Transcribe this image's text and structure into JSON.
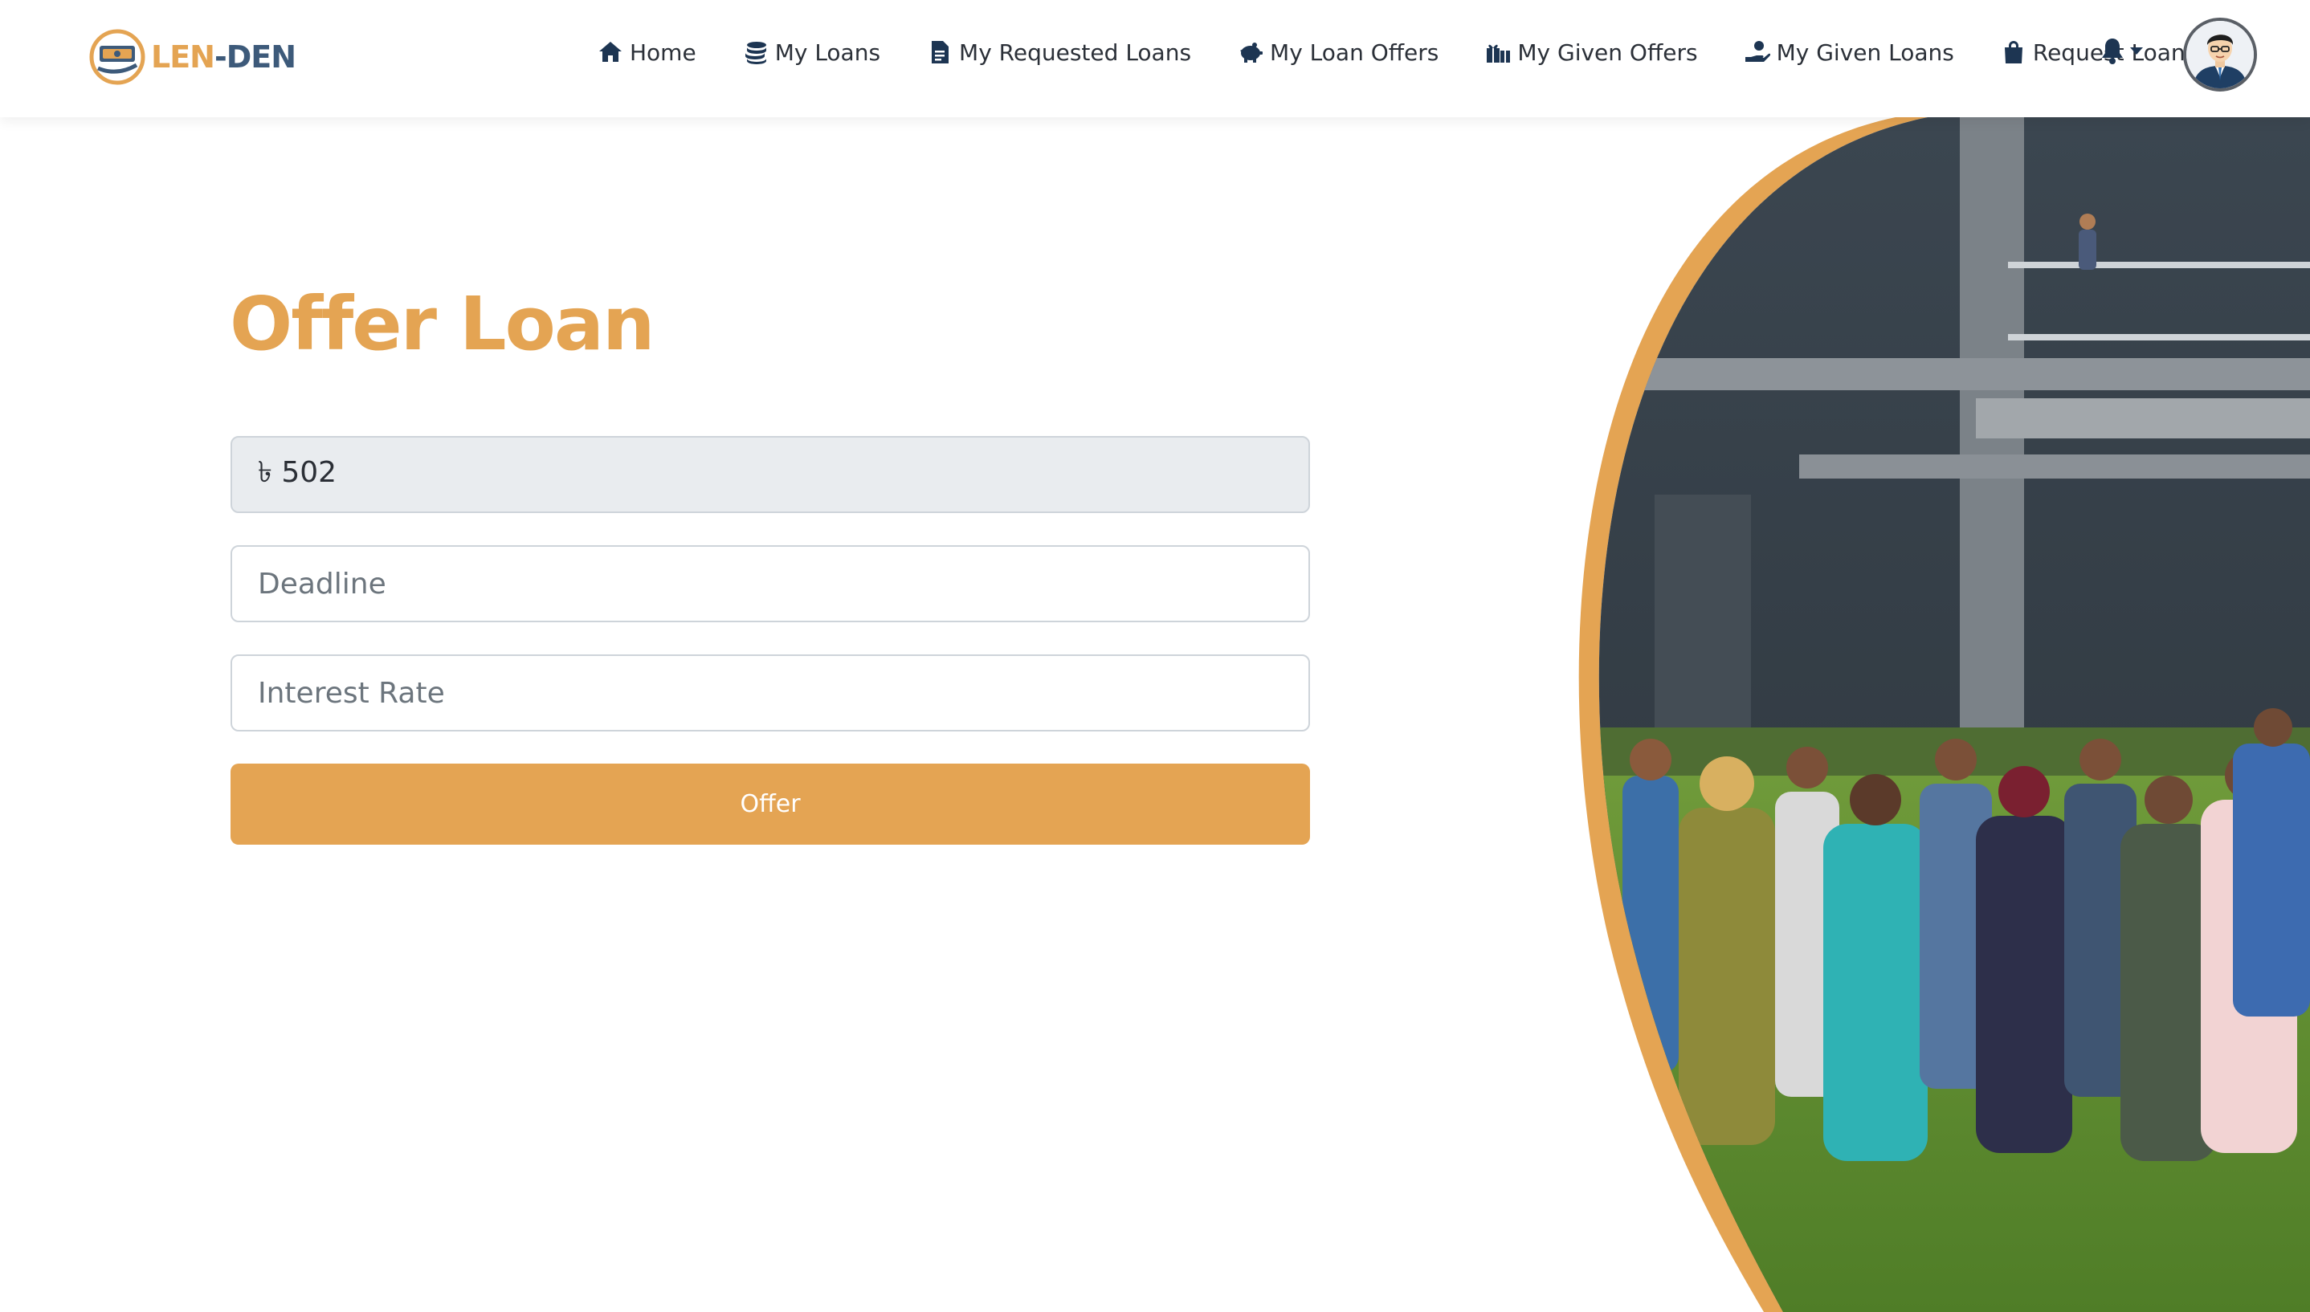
{
  "brand": {
    "part1": "LEN",
    "dash": "-",
    "part2": "DEN"
  },
  "nav": {
    "items": [
      {
        "label": "Home",
        "icon": "home-icon"
      },
      {
        "label": "My Loans",
        "icon": "coins-icon"
      },
      {
        "label": "My Requested Loans",
        "icon": "document-icon"
      },
      {
        "label": "My Loan Offers",
        "icon": "piggy-bank-icon"
      },
      {
        "label": "My Given Offers",
        "icon": "gifts-icon"
      },
      {
        "label": "My Given Loans",
        "icon": "hand-holding-dollar-icon"
      },
      {
        "label": "Request Loan",
        "icon": "shopping-bag-icon"
      }
    ],
    "bell_icon": "bell-icon",
    "avatar_icon": "user-avatar"
  },
  "form": {
    "title": "Offer Loan",
    "amount_value": "৳ 502",
    "deadline_placeholder": "Deadline",
    "interest_placeholder": "Interest Rate",
    "submit_label": "Offer"
  },
  "colors": {
    "accent": "#e4a453",
    "navy": "#1d3552",
    "disabled_bg": "#e9ecef"
  }
}
